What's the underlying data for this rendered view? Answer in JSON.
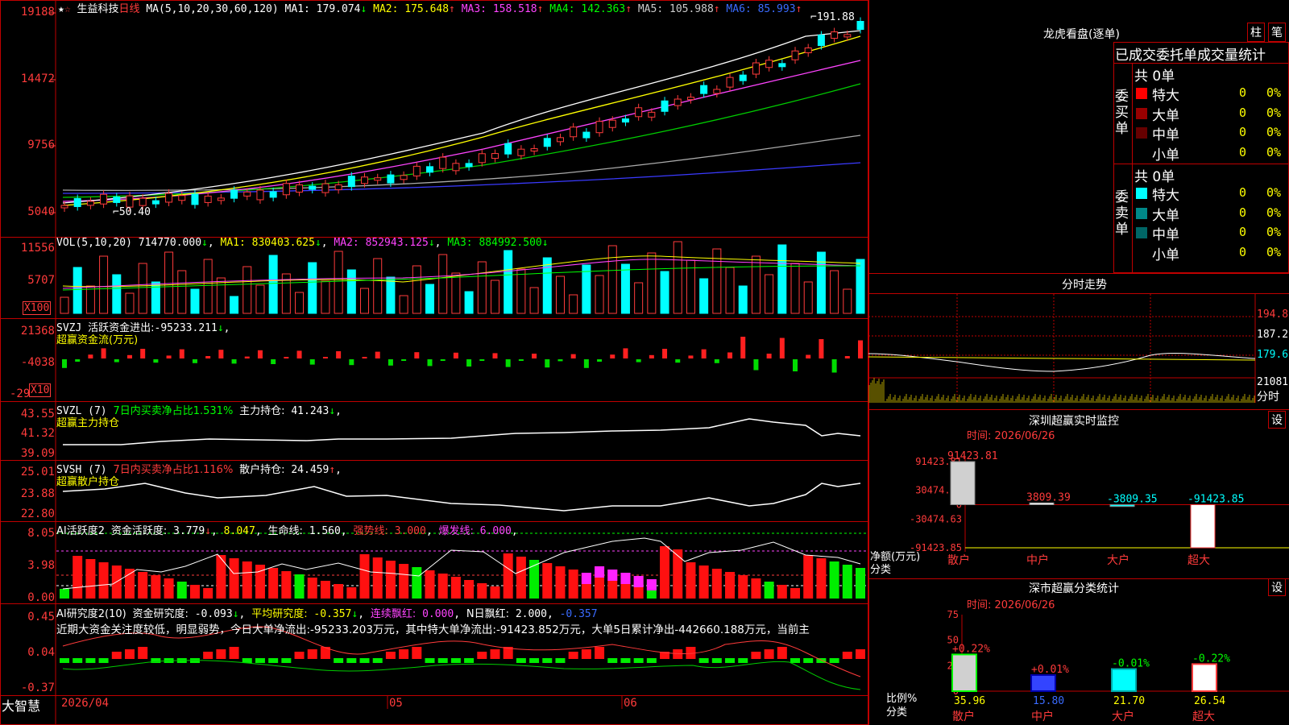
{
  "main": {
    "stock_name": "生益科技",
    "period": "日线",
    "ma_param": "MA(5,10,20,30,60,120)",
    "ma": [
      {
        "label": "MA1:",
        "value": "179.074",
        "arrow": "↓",
        "color": "#ffffff"
      },
      {
        "label": "MA2:",
        "value": "175.648",
        "arrow": "↑",
        "color": "#ffff00"
      },
      {
        "label": "MA3:",
        "value": "158.518",
        "arrow": "↑",
        "color": "#ff44ff"
      },
      {
        "label": "MA4:",
        "value": "142.363",
        "arrow": "↑",
        "color": "#00ff00"
      },
      {
        "label": "MA5:",
        "value": "105.988",
        "arrow": "↑",
        "color": "#cccccc"
      },
      {
        "label": "MA6:",
        "value": "85.993",
        "arrow": "↑",
        "color": "#3a6bff"
      }
    ],
    "high_label": "191.88",
    "low_label": "50.40",
    "y_ticks": [
      "19188",
      "14472",
      "9756",
      "5040"
    ]
  },
  "vol": {
    "param": "VOL(5,10,20)",
    "value": "714770.000",
    "value_arrow": "↓",
    "ma1": "830403.625",
    "ma1_arrow": "↓",
    "ma2": "852943.125",
    "ma2_arrow": "↓",
    "ma3": "884992.500",
    "ma3_arrow": "↓",
    "y_ticks": [
      "11556",
      "5707"
    ],
    "unit": "X100"
  },
  "svzj": {
    "name": "SVZJ",
    "label": "活跃资金进出:",
    "value": "-95233.211",
    "arrow": "↓",
    "subtitle": "超赢资金流(万元)",
    "y_ticks": [
      "21368",
      "-4038",
      "-29"
    ],
    "unit": "X10"
  },
  "svzl": {
    "name": "SVZL (7)",
    "label": "7日内买卖净占比1.531%",
    "label2": "主力持仓:",
    "value": "41.243",
    "arrow": "↓",
    "subtitle": "超赢主力持仓",
    "y_ticks": [
      "43.55",
      "41.32",
      "39.09"
    ]
  },
  "svsh": {
    "name": "SVSH (7)",
    "label": "7日内买卖净占比1.116%",
    "label2": "散户持仓:",
    "value": "24.459",
    "arrow": "↑",
    "subtitle": "超赢散户持仓",
    "y_ticks": [
      "25.01",
      "23.88",
      "22.80"
    ]
  },
  "ai1": {
    "name": "AI活跃度2",
    "label": "资金活跃度:",
    "value": "3.779",
    "arrow": "↓",
    "v2": "8.047",
    "life_label": "生命线:",
    "life_value": "1.560",
    "strong_label": "强势线:",
    "strong_value": "3.000",
    "burst_label": "爆发线:",
    "burst_value": "6.000",
    "y_ticks": [
      "8.05",
      "3.98",
      "0.00"
    ]
  },
  "ai2": {
    "name": "AI研究度2(10)",
    "label": "资金研究度:",
    "value": "-0.093",
    "arrow": "↓",
    "avg_label": "平均研究度:",
    "avg_value": "-0.357",
    "avg_arrow": "↓",
    "cont_label": "连续飘红:",
    "cont_value": "0.000",
    "n_label": "N日飘红:",
    "n_value": "2.000",
    "extra": "-0.357",
    "comment": "近期大资金关注度较低，明显弱势，今日大单净流出:-95233.203万元，其中特大单净流出:-91423.852万元，大单5日累计净出-442660.188万元，当前主",
    "y_ticks": [
      "0.45",
      "0.04",
      "-0.37"
    ]
  },
  "xaxis": {
    "labels": [
      "2026/04",
      "05",
      "06"
    ],
    "brand": "大智慧"
  },
  "right": {
    "lhkp_title": "龙虎看盘(逐单)",
    "btn_zhu": "柱",
    "btn_bi": "笔",
    "stats_title": "已成交委托单成交量统计",
    "buy_label": "委买单",
    "sell_label": "委卖单",
    "buy_total": "共 0单",
    "sell_total": "共 0单",
    "buy_rows": [
      {
        "name": "特大",
        "count": "0",
        "pct": "0%",
        "color": "#ff0000"
      },
      {
        "name": "大单",
        "count": "0",
        "pct": "0%",
        "color": "#990000"
      },
      {
        "name": "中单",
        "count": "0",
        "pct": "0%",
        "color": "#660000"
      },
      {
        "name": "小单",
        "count": "0",
        "pct": "0%",
        "color": "#000000"
      }
    ],
    "sell_rows": [
      {
        "name": "特大",
        "count": "0",
        "pct": "0%",
        "color": "#00ffff"
      },
      {
        "name": "大单",
        "count": "0",
        "pct": "0%",
        "color": "#008888"
      },
      {
        "name": "中单",
        "count": "0",
        "pct": "0%",
        "color": "#006666"
      },
      {
        "name": "小单",
        "count": "0",
        "pct": "0%",
        "color": "#000000"
      }
    ],
    "fs_title": "分时走势",
    "fs_ticks": [
      "194.8",
      "187.2",
      "179.6",
      "21081"
    ],
    "fs_unit": "分时",
    "sz_title": "深圳超赢实时监控",
    "sz_btn": "设",
    "sz_time": "时间: 2026/06/26",
    "sz_y": [
      "91423.81",
      "30474.59",
      "0",
      "-30474.63",
      "-91423.85"
    ],
    "sz_ylabel": "净额(万元)",
    "sz_xlabel": "分类",
    "sz_values": [
      "91423.81",
      "3809.39",
      "-3809.35",
      "-91423.85"
    ],
    "sz_cats": [
      "散户",
      "中户",
      "大户",
      "超大"
    ],
    "ss_title": "深市超赢分类统计",
    "ss_btn": "设",
    "ss_time": "时间: 2026/06/26",
    "ss_y": [
      "75",
      "50",
      "25",
      "0"
    ],
    "ss_ylabel": "比例%",
    "ss_xlabel": "分类",
    "ss_changes": [
      "+0.22%",
      "+0.01%",
      "-0.01%",
      "-0.22%"
    ],
    "ss_values": [
      "35.96",
      "15.80",
      "21.70",
      "26.54"
    ],
    "ss_cats": [
      "散户",
      "中户",
      "大户",
      "超大"
    ]
  },
  "chart_data": [
    {
      "type": "bar",
      "title": "深圳超赢实时监控",
      "ylabel": "净额(万元)",
      "xlabel": "分类",
      "categories": [
        "散户",
        "中户",
        "大户",
        "超大"
      ],
      "values": [
        91423.81,
        3809.39,
        -3809.35,
        -91423.85
      ],
      "ylim": [
        -91423.85,
        91423.81
      ]
    },
    {
      "type": "bar",
      "title": "深市超赢分类统计",
      "ylabel": "比例%",
      "xlabel": "分类",
      "categories": [
        "散户",
        "中户",
        "大户",
        "超大"
      ],
      "values": [
        35.96,
        15.8,
        21.7,
        26.54
      ],
      "ylim": [
        0,
        75
      ]
    }
  ]
}
